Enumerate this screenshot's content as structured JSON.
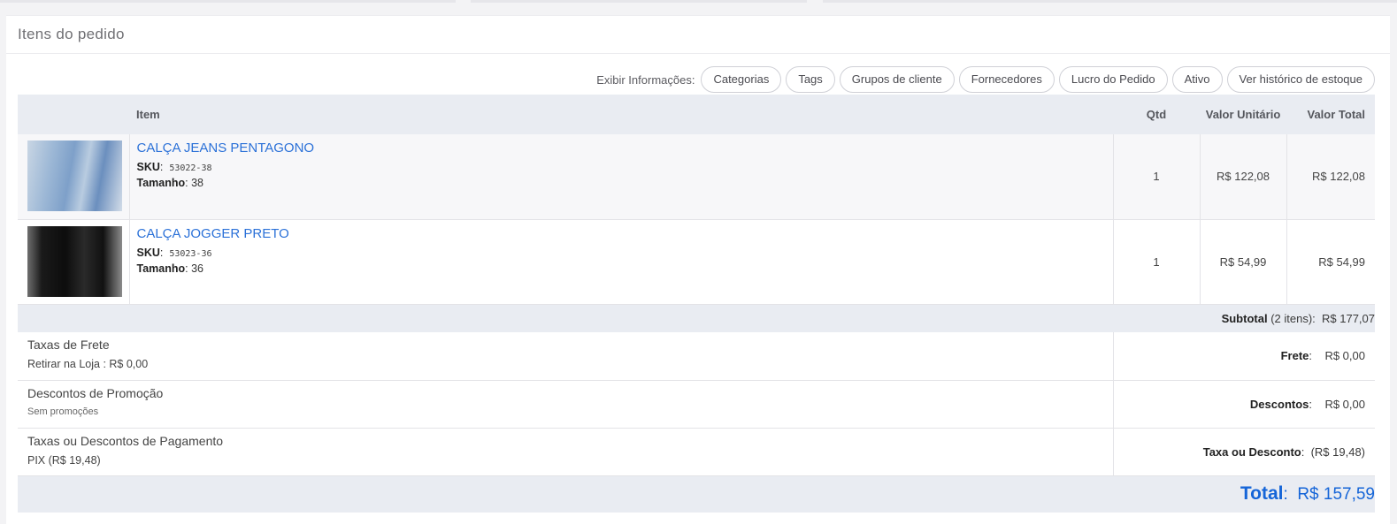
{
  "card": {
    "title": "Itens do pedido"
  },
  "filters": {
    "label": "Exibir Informações:",
    "buttons": [
      "Categorias",
      "Tags",
      "Grupos de cliente",
      "Fornecedores",
      "Lucro do Pedido",
      "Ativo",
      "Ver histórico de estoque"
    ]
  },
  "table": {
    "headers": {
      "item": "Item",
      "qty": "Qtd",
      "unit": "Valor Unitário",
      "total": "Valor Total"
    },
    "rows": [
      {
        "name": "CALÇA JEANS PENTAGONO",
        "sku_label": "SKU",
        "sku": "53022-38",
        "size_label": "Tamanho",
        "size": "38",
        "qty": "1",
        "unit": "R$ 122,08",
        "total": "R$ 122,08"
      },
      {
        "name": "CALÇA JOGGER PRETO",
        "sku_label": "SKU",
        "sku": "53023-36",
        "size_label": "Tamanho",
        "size": "36",
        "qty": "1",
        "unit": "R$ 54,99",
        "total": "R$ 54,99"
      }
    ]
  },
  "subtotal": {
    "label": "Subtotal",
    "count": "(2 itens):",
    "value": "R$ 177,07"
  },
  "fees": [
    {
      "title": "Taxas de Frete",
      "detail": "Retirar na Loja : R$ 0,00",
      "right_label": "Frete",
      "right_value": "R$ 0,00"
    },
    {
      "title": "Descontos de Promoção",
      "detail": "Sem promoções",
      "right_label": "Descontos",
      "right_value": "R$ 0,00"
    },
    {
      "title": "Taxas ou Descontos de Pagamento",
      "detail": "PIX (R$ 19,48)",
      "right_label": "Taxa ou Desconto",
      "right_value": "(R$ 19,48)"
    }
  ],
  "total": {
    "label": "Total",
    "value": "R$ 157,59"
  },
  "colors": {
    "accent": "#2b71d8",
    "total": "#1565d8",
    "header_bg": "#e9ecf2"
  }
}
